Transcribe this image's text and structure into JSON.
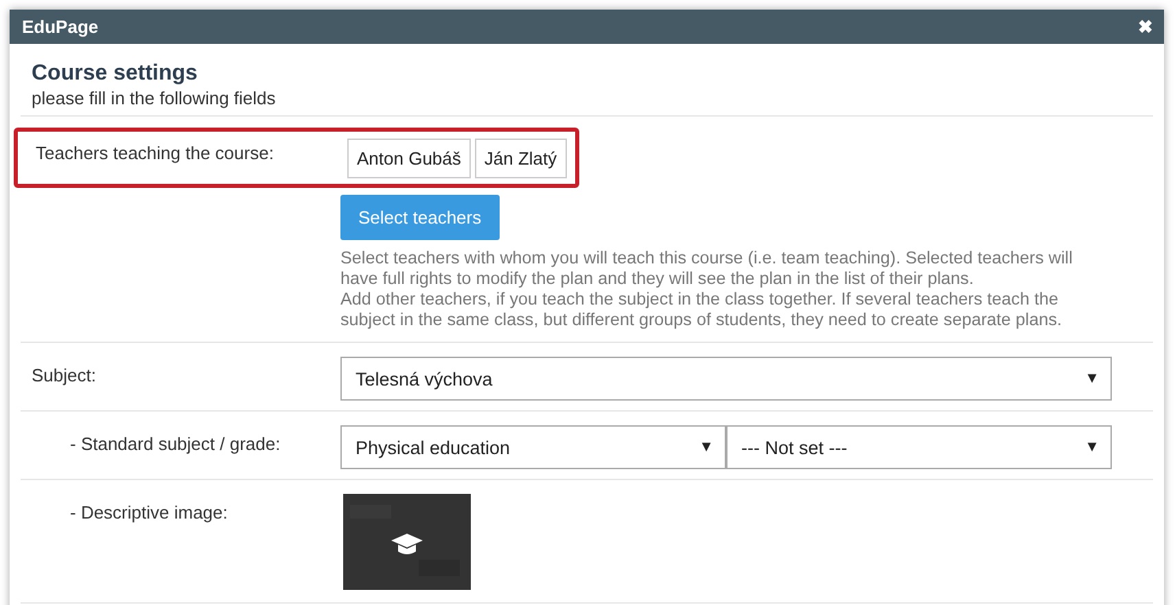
{
  "window": {
    "title": "EduPage",
    "close": "✖"
  },
  "header": {
    "title": "Course settings",
    "subtitle": "please fill in the following fields"
  },
  "teachers": {
    "label": "Teachers teaching the course:",
    "highlighted": true,
    "names": [
      "Anton Gubáš",
      "Ján Zlatý"
    ],
    "button": "Select teachers",
    "help": [
      "Select teachers with whom you will teach this course (i.e. team teaching). Selected teachers will have full rights to modify the plan and they will see the plan in the list of their plans.",
      "Add other teachers, if you teach the subject in the class together. If several teachers teach the subject in the same class, but different groups of students, they need to create separate plans."
    ]
  },
  "fields": [
    {
      "kind": "select",
      "label": "Subject:",
      "indented": false,
      "selects": [
        {
          "value": "Telesná výchova",
          "arrow": "▼"
        }
      ]
    },
    {
      "kind": "select",
      "label": "- Standard subject / grade:",
      "indented": true,
      "selects": [
        {
          "value": "Physical education",
          "arrow": "▼"
        },
        {
          "value": "--- Not set ---",
          "arrow": "▼"
        }
      ]
    },
    {
      "label": "- Descriptive image:",
      "indented": true
    }
  ]
}
